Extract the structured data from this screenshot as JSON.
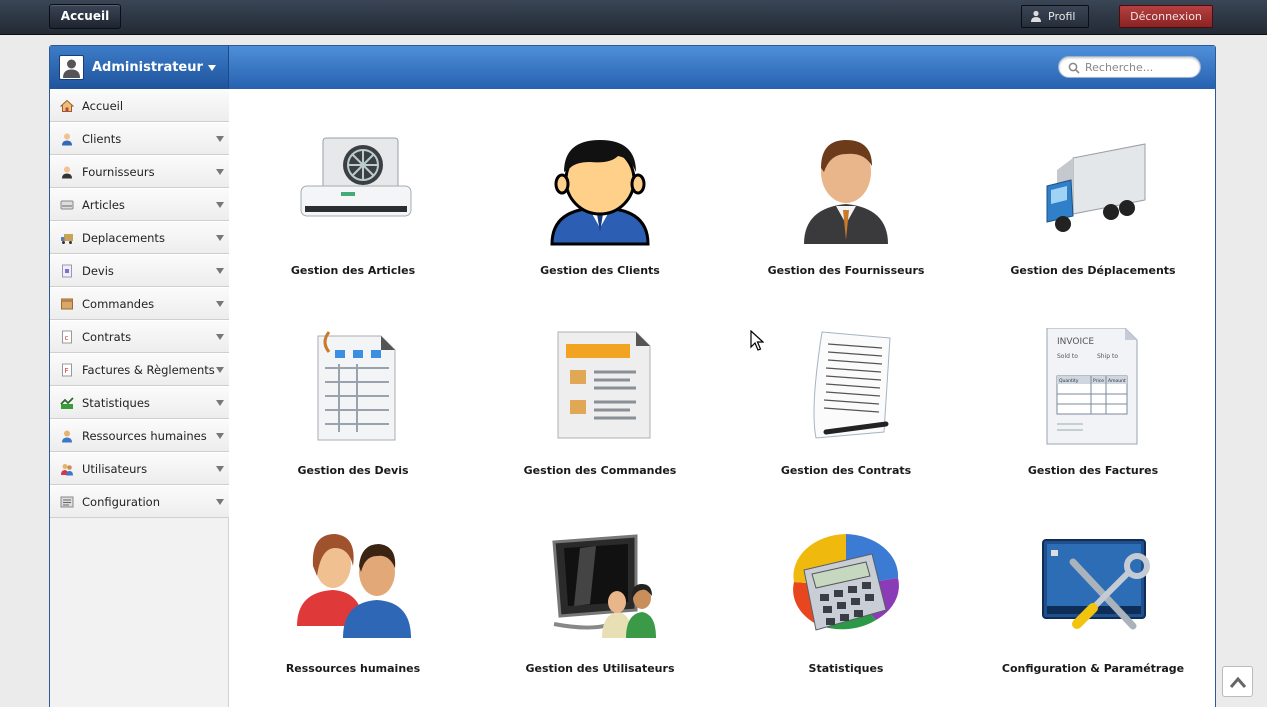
{
  "topbar": {
    "home_label": "Accueil",
    "profile_label": "Profil",
    "logout_label": "Déconnexion"
  },
  "header": {
    "user_name": "Administrateur",
    "search_placeholder": "Recherche..."
  },
  "sidebar": {
    "items": [
      {
        "label": "Accueil",
        "icon": "home-icon"
      },
      {
        "label": "Clients",
        "icon": "client-icon"
      },
      {
        "label": "Fournisseurs",
        "icon": "supplier-icon"
      },
      {
        "label": "Articles",
        "icon": "articles-icon"
      },
      {
        "label": "Deplacements",
        "icon": "truck-icon"
      },
      {
        "label": "Devis",
        "icon": "quote-icon"
      },
      {
        "label": "Commandes",
        "icon": "orders-icon"
      },
      {
        "label": "Contrats",
        "icon": "contract-icon"
      },
      {
        "label": "Factures & Règlements",
        "icon": "invoice-icon"
      },
      {
        "label": "Statistiques",
        "icon": "stats-icon"
      },
      {
        "label": "Ressources humaines",
        "icon": "hr-icon"
      },
      {
        "label": "Utilisateurs",
        "icon": "users-icon"
      },
      {
        "label": "Configuration",
        "icon": "config-icon"
      }
    ]
  },
  "tiles": [
    {
      "label": "Gestion des Articles",
      "icon": "air-conditioner-icon"
    },
    {
      "label": "Gestion des Clients",
      "icon": "client-avatar-icon"
    },
    {
      "label": "Gestion des Fournisseurs",
      "icon": "businessman-icon"
    },
    {
      "label": "Gestion des Déplacements",
      "icon": "delivery-truck-icon"
    },
    {
      "label": "Gestion des Devis",
      "icon": "spreadsheet-icon"
    },
    {
      "label": "Gestion des Commandes",
      "icon": "order-document-icon"
    },
    {
      "label": "Gestion des Contrats",
      "icon": "contract-pen-icon"
    },
    {
      "label": "Gestion des Factures",
      "icon": "invoice-document-icon"
    },
    {
      "label": "Ressources humaines",
      "icon": "people-icon"
    },
    {
      "label": "Gestion des Utilisateurs",
      "icon": "monitor-users-icon"
    },
    {
      "label": "Statistiques",
      "icon": "calculator-pie-icon"
    },
    {
      "label": "Configuration & Paramétrage",
      "icon": "tools-icon"
    }
  ],
  "invoice_art": {
    "title": "INVOICE",
    "sold_to": "Sold to",
    "ship_to": "Ship to",
    "col1": "Quantity",
    "col2": "Price",
    "col3": "Amount"
  },
  "colors": {
    "header_blue": "#2f6ec0",
    "logout_red": "#a63232",
    "topbar": "#2a323f"
  }
}
